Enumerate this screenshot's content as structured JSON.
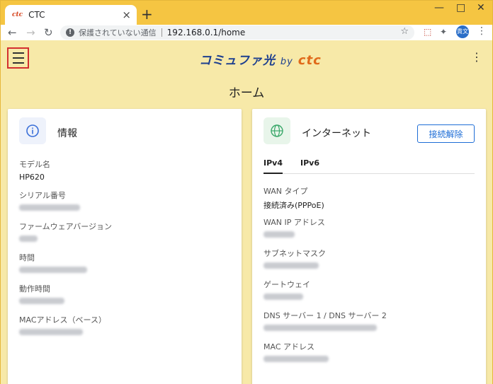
{
  "browser": {
    "tab_title": "CTC",
    "favicon_text": "ctc",
    "new_tab": "+",
    "close_tab": "×",
    "minimize": "—",
    "restore": "□",
    "close_window": "✕",
    "security_warning": "保護されていない通信",
    "url": "192.168.0.1/home",
    "avatar": "貴文"
  },
  "app": {
    "logo_main": "コミュファ光",
    "logo_by": "by",
    "logo_ctc": "ctc",
    "page_title": "ホーム"
  },
  "info_card": {
    "title": "情報",
    "fields": [
      {
        "label": "モデル名",
        "value": "HP620"
      },
      {
        "label": "シリアル番号",
        "value": ""
      },
      {
        "label": "ファームウェアバージョン",
        "value": ""
      },
      {
        "label": "時間",
        "value": ""
      },
      {
        "label": "動作時間",
        "value": ""
      },
      {
        "label": "MACアドレス（ベース）",
        "value": ""
      }
    ]
  },
  "internet_card": {
    "title": "インターネット",
    "disconnect_label": "接続解除",
    "tabs": [
      {
        "label": "IPv4",
        "active": true
      },
      {
        "label": "IPv6",
        "active": false
      }
    ],
    "fields": [
      {
        "label": "WAN タイプ",
        "value": "接続済み(PPPoE)"
      },
      {
        "label": "WAN IP アドレス",
        "value": ""
      },
      {
        "label": "サブネットマスク",
        "value": ""
      },
      {
        "label": "ゲートウェイ",
        "value": ""
      },
      {
        "label": "DNS サーバー 1 / DNS サーバー 2",
        "value": ""
      },
      {
        "label": "MAC アドレス",
        "value": ""
      }
    ]
  },
  "colors": {
    "highlight_border": "#d32f2f",
    "accent_blue": "#1e6dd6",
    "browser_frame": "#f5c542"
  }
}
